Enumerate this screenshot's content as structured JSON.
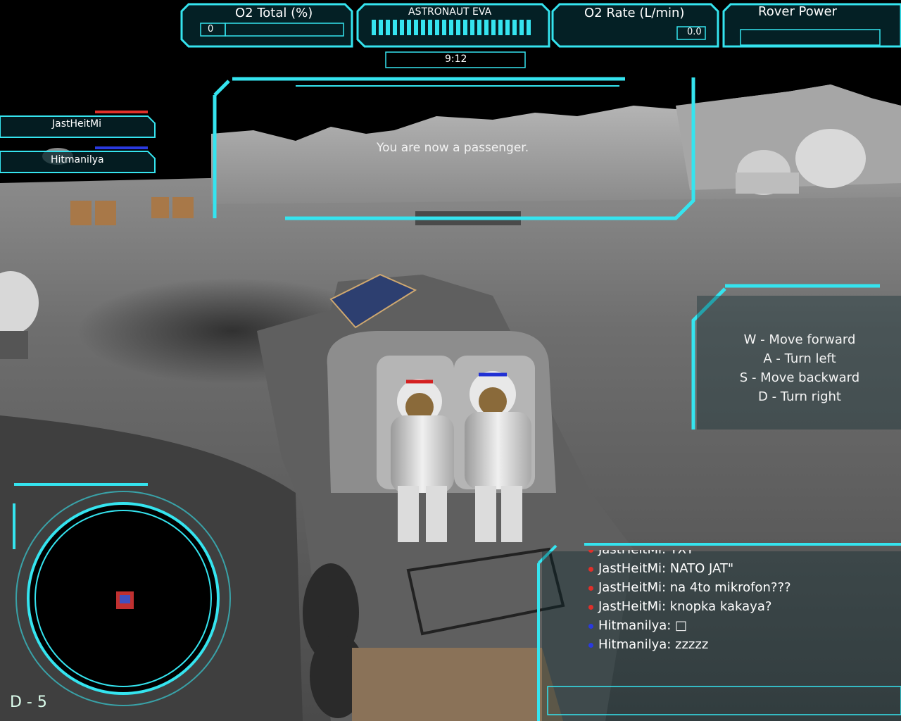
{
  "hud": {
    "o2_total_label": "O2 Total (%)",
    "o2_total_value": "0",
    "eva_label": "ASTRONAUT EVA",
    "eva_timer": "9:12",
    "o2_rate_label": "O2 Rate (L/min)",
    "o2_rate_value": "0.0",
    "rover_power_label": "Rover Power"
  },
  "players": [
    {
      "name": "JastHeitMi",
      "color": "#e0302a"
    },
    {
      "name": "Hitmanilya",
      "color": "#2a3ae0"
    }
  ],
  "message": "You are now a passenger.",
  "controls": [
    "W - Move forward",
    "A - Turn left",
    "S - Move backward",
    "D - Turn right"
  ],
  "chat": [
    {
      "text": "JastHeitMi: TXT",
      "color": "#e0302a"
    },
    {
      "text": "JastHeitMi: NATO JAT\"",
      "color": "#e0302a"
    },
    {
      "text": "JastHeitMi: na 4to mikrofon???",
      "color": "#e0302a"
    },
    {
      "text": "JastHeitMi: knopka kakaya?",
      "color": "#e0302a"
    },
    {
      "text": "Hitmanilya: □",
      "color": "#2a3ae0"
    },
    {
      "text": "Hitmanilya: zzzzz",
      "color": "#2a3ae0"
    }
  ],
  "minimap": {
    "grid_label": "D - 5"
  },
  "colors": {
    "hud_cyan": "#35e4ef",
    "hud_bg": "#05262c"
  }
}
